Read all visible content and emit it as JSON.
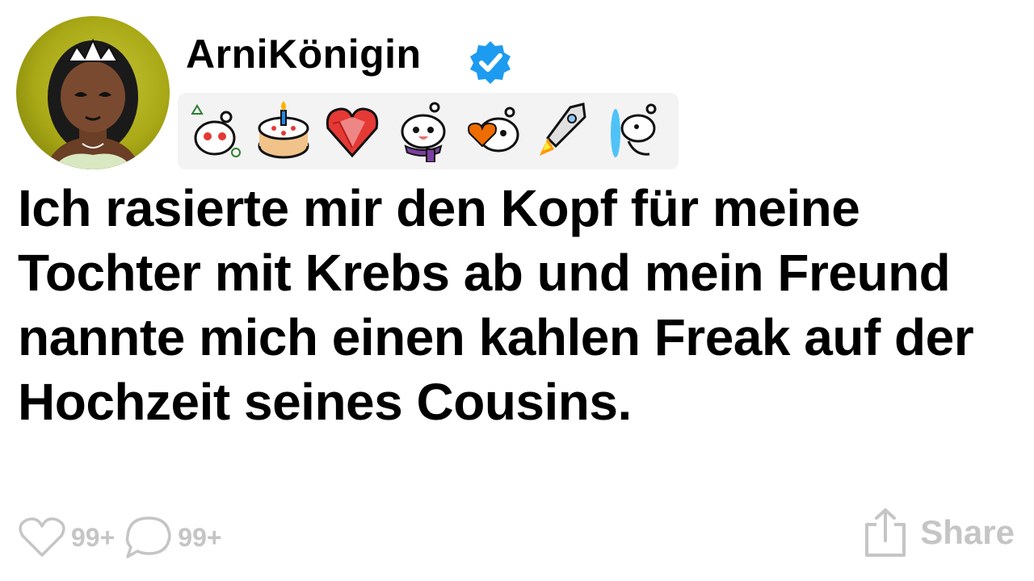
{
  "post": {
    "username": "ArniKönigin",
    "title": "Ich rasierte mir den Kopf für meine Tochter mit Krebs ab und mein Freund nannte mich einen kahlen Freak auf der Hochzeit seines Cousins."
  },
  "awards": [
    {
      "icon": "snoo-party-award-icon"
    },
    {
      "icon": "cake-award-icon"
    },
    {
      "icon": "crystal-heart-award-icon"
    },
    {
      "icon": "snoo-scarf-award-icon"
    },
    {
      "icon": "snoo-heart-award-icon"
    },
    {
      "icon": "rocket-award-icon"
    },
    {
      "icon": "snoo-portal-award-icon"
    }
  ],
  "actions": {
    "likes": "99+",
    "comments": "99+",
    "share_label": "Share"
  },
  "colors": {
    "verified_badge": "#1d9bf0",
    "muted_gray": "#c5c5c5",
    "award_strip_bg": "#f3f3f4",
    "avatar_bg": "#a9a816"
  }
}
